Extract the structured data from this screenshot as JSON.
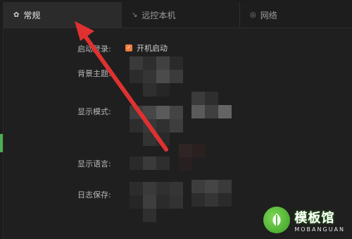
{
  "tabs": [
    {
      "label": "常规",
      "icon": "gear-icon",
      "active": true
    },
    {
      "label": "远控本机",
      "icon": "remote-icon",
      "active": false
    },
    {
      "label": "网络",
      "icon": "network-icon",
      "active": false
    }
  ],
  "settings": {
    "startup_label": "启动登录:",
    "startup_checkbox_label": "开机启动",
    "startup_checked": true,
    "theme_label": "背景主题:",
    "display_mode_label": "显示模式:",
    "language_label": "显示语言:",
    "log_label": "日志保存:"
  },
  "watermark": {
    "cn": "模板馆",
    "en": "MOBANGUAN"
  },
  "colors": {
    "accent": "#f07b3f",
    "arrow": "#e03131",
    "brand_green": "#4caf50"
  }
}
